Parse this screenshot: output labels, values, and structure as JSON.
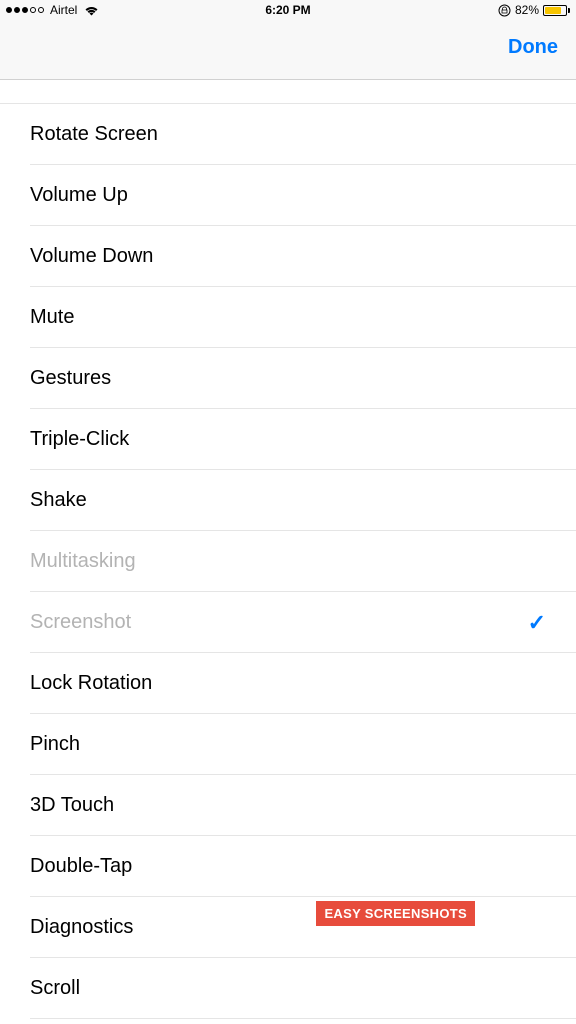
{
  "status_bar": {
    "carrier": "Airtel",
    "time": "6:20 PM",
    "battery_pct": "82%",
    "battery_fill_pct": 82
  },
  "nav": {
    "done_label": "Done"
  },
  "list": {
    "items": [
      {
        "label": "Rotate Screen",
        "disabled": false,
        "checked": false
      },
      {
        "label": "Volume Up",
        "disabled": false,
        "checked": false
      },
      {
        "label": "Volume Down",
        "disabled": false,
        "checked": false
      },
      {
        "label": "Mute",
        "disabled": false,
        "checked": false
      },
      {
        "label": "Gestures",
        "disabled": false,
        "checked": false
      },
      {
        "label": "Triple-Click",
        "disabled": false,
        "checked": false
      },
      {
        "label": "Shake",
        "disabled": false,
        "checked": false
      },
      {
        "label": "Multitasking",
        "disabled": true,
        "checked": false
      },
      {
        "label": "Screenshot",
        "disabled": true,
        "checked": true
      },
      {
        "label": "Lock Rotation",
        "disabled": false,
        "checked": false
      },
      {
        "label": "Pinch",
        "disabled": false,
        "checked": false
      },
      {
        "label": "3D Touch",
        "disabled": false,
        "checked": false
      },
      {
        "label": "Double-Tap",
        "disabled": false,
        "checked": false
      },
      {
        "label": "Diagnostics",
        "disabled": false,
        "checked": false
      },
      {
        "label": "Scroll",
        "disabled": false,
        "checked": false
      }
    ]
  },
  "watermark": "EASY SCREENSHOTS"
}
